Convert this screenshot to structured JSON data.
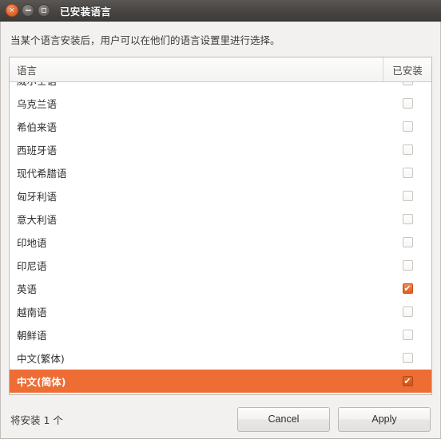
{
  "window": {
    "title": "已安装语言",
    "controls": [
      {
        "name": "close-button",
        "glyph": "×"
      },
      {
        "name": "minimize-button",
        "glyph": ""
      },
      {
        "name": "maximize-button",
        "glyph": ""
      }
    ]
  },
  "description": "当某个语言安装后，用户可以在他们的语言设置里进行选择。",
  "table": {
    "columns": {
      "language": "语言",
      "installed": "已安装"
    },
    "rows": [
      {
        "language": "威尔士语",
        "installed": false,
        "selected": false
      },
      {
        "language": "乌克兰语",
        "installed": false,
        "selected": false
      },
      {
        "language": "希伯来语",
        "installed": false,
        "selected": false
      },
      {
        "language": "西班牙语",
        "installed": false,
        "selected": false
      },
      {
        "language": "现代希腊语",
        "installed": false,
        "selected": false
      },
      {
        "language": "匈牙利语",
        "installed": false,
        "selected": false
      },
      {
        "language": "意大利语",
        "installed": false,
        "selected": false
      },
      {
        "language": "印地语",
        "installed": false,
        "selected": false
      },
      {
        "language": "印尼语",
        "installed": false,
        "selected": false
      },
      {
        "language": "英语",
        "installed": true,
        "selected": false
      },
      {
        "language": "越南语",
        "installed": false,
        "selected": false
      },
      {
        "language": "朝鲜语",
        "installed": false,
        "selected": false
      },
      {
        "language": "中文(繁体)",
        "installed": false,
        "selected": false
      },
      {
        "language": "中文(简体)",
        "installed": true,
        "selected": true
      }
    ]
  },
  "footer": {
    "status": "将安装 1 个",
    "cancel_label": "Cancel",
    "apply_label": "Apply"
  },
  "colors": {
    "selection": "#ed6d35",
    "titlebar": "#474341",
    "close_button": "#e8713a",
    "window_background": "#f2f1f0"
  },
  "check_glyph": "✔"
}
